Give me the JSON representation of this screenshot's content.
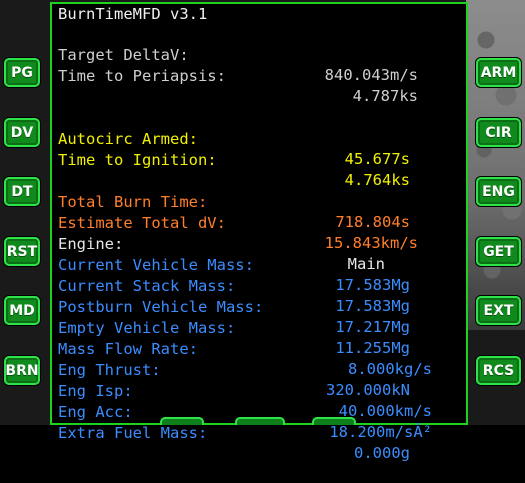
{
  "mfd": {
    "title": "BurnTimeMFD v3.1",
    "lines": [
      {
        "label": "Target DeltaV:",
        "value": "840.043m/s",
        "color": "gray"
      },
      {
        "label": "Time to Periapsis:",
        "value": "4.787ks",
        "color": "gray"
      },
      {
        "label": "",
        "value": "",
        "color": "gray"
      },
      {
        "label": "",
        "value": "",
        "color": "gray"
      },
      {
        "label": "Autocirc Armed:",
        "value": "45.677s",
        "color": "yellow"
      },
      {
        "label": "Time to Ignition:",
        "value": "4.764ks",
        "color": "yellow"
      },
      {
        "label": "",
        "value": "",
        "color": "gray"
      },
      {
        "label": "Total Burn Time:",
        "value": "718.804s",
        "color": "orange"
      },
      {
        "label": "Estimate Total dV:",
        "value": "15.843km/s",
        "color": "orange"
      },
      {
        "label": "Engine:",
        "value": "Main",
        "color": "white"
      },
      {
        "label": "Current Vehicle Mass:",
        "value": "17.583Mg",
        "color": "blue"
      },
      {
        "label": "Current Stack Mass:",
        "value": "17.583Mg",
        "color": "blue"
      },
      {
        "label": "Postburn Vehicle Mass:",
        "value": "17.217Mg",
        "color": "blue"
      },
      {
        "label": "Empty Vehicle Mass:",
        "value": "11.255Mg",
        "color": "blue"
      },
      {
        "label": "Mass Flow Rate:",
        "value": "8.000kg/s",
        "color": "blue"
      },
      {
        "label": "Eng Thrust:",
        "value": "320.000kN",
        "color": "blue"
      },
      {
        "label": "Eng Isp:",
        "value": "40.000km/s",
        "color": "blue"
      },
      {
        "label": "Eng Acc:",
        "value": "18.200m/sÂ²",
        "color": "blue"
      },
      {
        "label": "Extra Fuel Mass:",
        "value": "0.000g",
        "color": "blue"
      }
    ]
  },
  "buttons": {
    "left": [
      "PG",
      "DV",
      "DT",
      "RST",
      "MD",
      "BRN"
    ],
    "right": [
      "ARM",
      "CIR",
      "ENG",
      "GET",
      "EXT",
      "RCS"
    ]
  },
  "colors": {
    "frame": "#1dd31d",
    "button_fill": "#118a1d",
    "button_border": "#2ee34a",
    "yellow": "#f0f000",
    "orange": "#ff7f2a",
    "blue": "#3b8dff"
  }
}
